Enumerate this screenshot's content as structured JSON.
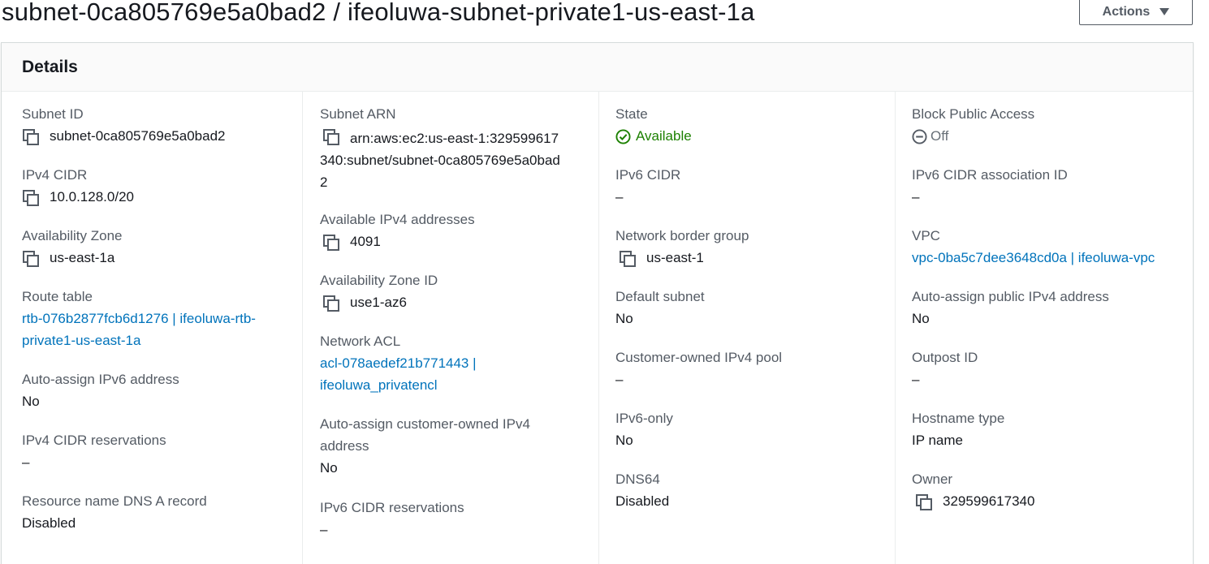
{
  "header": {
    "title": "subnet-0ca805769e5a0bad2 / ifeoluwa-subnet-private1-us-east-1a",
    "actions_label": "Actions"
  },
  "panel": {
    "title": "Details"
  },
  "columns": {
    "c1": {
      "subnet_id": {
        "label": "Subnet ID",
        "value": "subnet-0ca805769e5a0bad2"
      },
      "ipv4_cidr": {
        "label": "IPv4 CIDR",
        "value": "10.0.128.0/20"
      },
      "az": {
        "label": "Availability Zone",
        "value": "us-east-1a"
      },
      "route_table": {
        "label": "Route table",
        "value": "rtb-076b2877fcb6d1276 | ifeoluwa-rtb-private1-us-east-1a"
      },
      "auto_ipv6": {
        "label": "Auto-assign IPv6 address",
        "value": "No"
      },
      "ipv4_res": {
        "label": "IPv4 CIDR reservations",
        "value": "–"
      },
      "dns_a": {
        "label": "Resource name DNS A record",
        "value": "Disabled"
      }
    },
    "c2": {
      "arn": {
        "label": "Subnet ARN",
        "value": "arn:aws:ec2:us-east-1:329599617340:subnet/subnet-0ca805769e5a0bad2"
      },
      "avail_ipv4": {
        "label": "Available IPv4 addresses",
        "value": "4091"
      },
      "az_id": {
        "label": "Availability Zone ID",
        "value": "use1-az6"
      },
      "acl": {
        "label": "Network ACL",
        "value": "acl-078aedef21b771443 | ifeoluwa_privatencl"
      },
      "auto_cust": {
        "label": "Auto-assign customer-owned IPv4 address",
        "value": "No"
      },
      "ipv6_res": {
        "label": "IPv6 CIDR reservations",
        "value": "–"
      }
    },
    "c3": {
      "state": {
        "label": "State",
        "value": "Available"
      },
      "ipv6_cidr": {
        "label": "IPv6 CIDR",
        "value": "–"
      },
      "nbg": {
        "label": "Network border group",
        "value": "us-east-1"
      },
      "default": {
        "label": "Default subnet",
        "value": "No"
      },
      "cust_pool": {
        "label": "Customer-owned IPv4 pool",
        "value": "–"
      },
      "ipv6_only": {
        "label": "IPv6-only",
        "value": "No"
      },
      "dns64": {
        "label": "DNS64",
        "value": "Disabled"
      }
    },
    "c4": {
      "bpa": {
        "label": "Block Public Access",
        "value": "Off"
      },
      "ipv6_assoc": {
        "label": "IPv6 CIDR association ID",
        "value": "–"
      },
      "vpc": {
        "label": "VPC",
        "value": "vpc-0ba5c7dee3648cd0a | ifeoluwa-vpc"
      },
      "auto_pub": {
        "label": "Auto-assign public IPv4 address",
        "value": "No"
      },
      "outpost": {
        "label": "Outpost ID",
        "value": "–"
      },
      "hostname": {
        "label": "Hostname type",
        "value": "IP name"
      },
      "owner": {
        "label": "Owner",
        "value": "329599617340"
      }
    }
  },
  "colors": {
    "link": "#0073bb",
    "success": "#1d8102",
    "label": "#545b64",
    "text": "#16191f"
  },
  "icons": {
    "copy": "copy-icon",
    "status_ok": "check-circle-icon",
    "status_off": "minus-circle-icon",
    "dropdown": "caret-down-icon"
  }
}
